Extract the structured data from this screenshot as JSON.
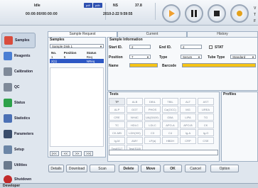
{
  "status": {
    "state": "Idle",
    "clock": "00:00:00/00:00:00",
    "pill1": "pdf",
    "pill2": "pdh",
    "ns_label": "NS",
    "temp": "37.8",
    "datetime": "2010-2-22 9:59:55",
    "right_letters": [
      "V",
      "T",
      "F"
    ]
  },
  "sidebar": {
    "items": [
      {
        "label": "Samples",
        "icon": "sample-tube-icon",
        "color": "#d94c3d"
      },
      {
        "label": "Reagents",
        "icon": "reagent-bottle-icon",
        "color": "#4a7ed3"
      },
      {
        "label": "Calibration",
        "icon": "calibration-icon",
        "color": "#7f8a99"
      },
      {
        "label": "QC",
        "icon": "qc-icon",
        "color": "#7f8a99"
      },
      {
        "label": "Status",
        "icon": "status-check-icon",
        "color": "#2da14a"
      },
      {
        "label": "Statistics",
        "icon": "statistics-icon",
        "color": "#4b70b5"
      },
      {
        "label": "Parameters",
        "icon": "parameters-icon",
        "color": "#3a4d6b"
      },
      {
        "label": "Setup",
        "icon": "setup-gear-icon",
        "color": "#6c86a7"
      },
      {
        "label": "Utilities",
        "icon": "utilities-icon",
        "color": "#6b7a8d"
      },
      {
        "label": "Shutdown",
        "icon": "shutdown-icon",
        "color": "#c22b2b"
      }
    ]
  },
  "tabs": [
    "Sample Request",
    "Current",
    "History"
  ],
  "samples_panel": {
    "title": "Samples",
    "disk": "Sample Disk 1",
    "columns": [
      "No.",
      "Position",
      "Status"
    ],
    "rows": [
      [
        "1",
        "6",
        "Req"
      ],
      [
        "2(1)",
        "",
        "NReq"
      ]
    ],
    "pager": [
      "|<<",
      "<<",
      ">>",
      ">>|"
    ]
  },
  "info": {
    "title": "Sample Information",
    "start_id_label": "Start ID.",
    "start_id": "2",
    "end_id_label": "End ID.",
    "end_id": "2",
    "stat_label": "STAT",
    "position_label": "Position",
    "position": "7",
    "type_label": "Type",
    "type": "Serum",
    "tube_type_label": "Tube Type",
    "tube_type": "Standard",
    "name_label": "Name",
    "name": "",
    "barcode_label": "Barcode",
    "barcode": ""
  },
  "tests": {
    "title": "Tests",
    "items": [
      "TP",
      "ALB",
      "DBIL",
      "TBIL",
      "ALT",
      "AST",
      "ALP",
      "GGT",
      "PHOS",
      "Ca(OCC)",
      "MG",
      "UREA",
      "CRE",
      "NH4C",
      "UA(Gt100-Pb)",
      "GBA",
      "LIPA",
      "TG",
      "TC",
      "HDLC",
      "LDLC",
      "APO-A",
      "APO-B",
      "CK",
      "CK-MB",
      "LDH(HH)",
      "C3",
      "C4",
      "Ig-A",
      "Ig-G",
      "Ig-M",
      "AMY",
      "LP(a)",
      "HBDH",
      "CRP",
      "CSE",
      "Test(S17",
      "Test(S18)"
    ]
  },
  "profiles": {
    "title": "Profiles"
  },
  "buttons": [
    "Details",
    "Download",
    "Scan",
    "Delete",
    "Move",
    "OK",
    "Cancel",
    "Option"
  ],
  "footer": {
    "left": "Developer"
  }
}
